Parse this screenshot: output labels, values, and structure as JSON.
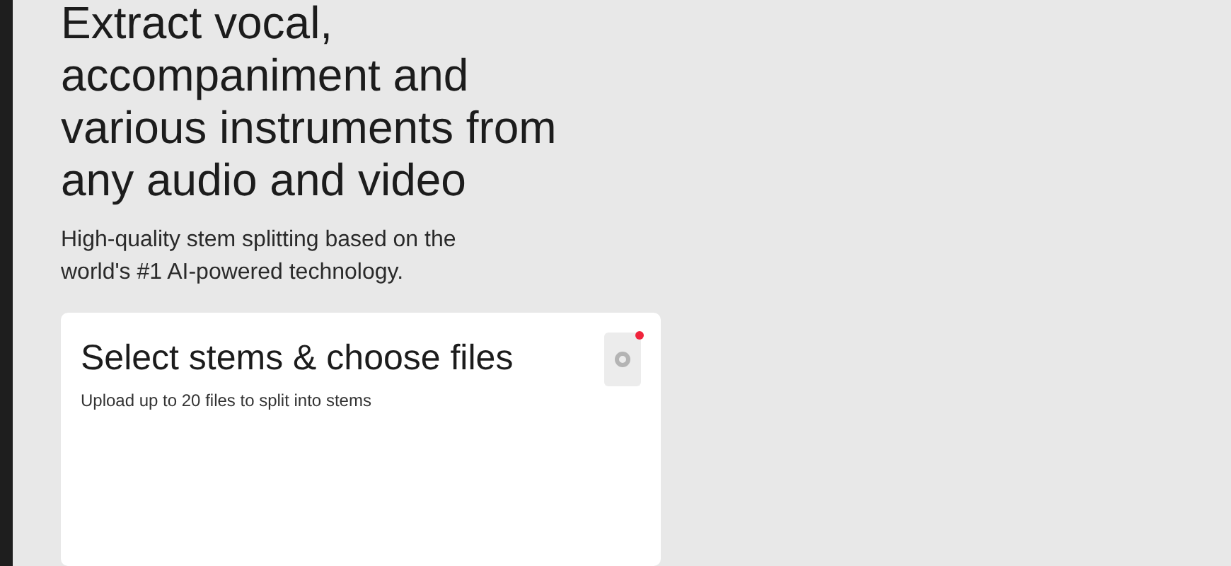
{
  "hero": {
    "title_lines": [
      "Extract vocal,",
      "accompaniment and",
      "various instruments from",
      "any audio and video"
    ],
    "subtitle_lines": [
      "High-quality stem splitting based on the",
      "world's #1 AI-powered technology."
    ]
  },
  "card": {
    "title": "Select stems & choose files",
    "subtitle": "Upload up to 20 files to split into stems",
    "settings_button": {
      "notification": true
    }
  }
}
